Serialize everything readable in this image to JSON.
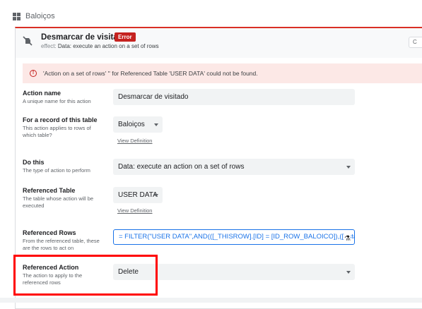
{
  "breadcrumb": {
    "table_name": "Baloiços",
    "icon": "grid-icon"
  },
  "header": {
    "title": "Desmarcar de visitado",
    "badge": "Error",
    "effect_label": "effect:",
    "effect_value": "Data: execute an action on a set of rows",
    "icon": "tap-off-icon",
    "right_button": "C"
  },
  "error_banner": {
    "icon": "error-circle-icon",
    "message": "'Action on a set of rows' '' for Referenced Table 'USER DATA' could not be found."
  },
  "fields": {
    "action_name": {
      "label": "Action name",
      "help": "A unique name for this action",
      "value": "Desmarcar de visitado"
    },
    "for_record": {
      "label": "For a record of this table",
      "help": "This action applies to rows of which table?",
      "value": "Baloiços",
      "link": "View Definition"
    },
    "do_this": {
      "label": "Do this",
      "help": "The type of action to perform",
      "value": "Data: execute an action on a set of rows"
    },
    "referenced_table": {
      "label": "Referenced Table",
      "help": "The table whose action will be executed",
      "value": "USER DATA",
      "link": "View Definition"
    },
    "referenced_rows": {
      "label": "Referenced Rows",
      "help": "From the referenced table, these are the rows to act on",
      "value": "=  FILTER(\"USER DATA\",AND(([_THISROW].[ID] = [ID_ROW_BALOICO]),([Esta",
      "icon": "flask-icon"
    },
    "referenced_action": {
      "label": "Referenced Action",
      "help": "The action to apply to the referenced rows",
      "value": "Delete"
    }
  },
  "colors": {
    "error": "#c5221f",
    "accent": "#1a73e8",
    "highlight": "#ff0000"
  }
}
